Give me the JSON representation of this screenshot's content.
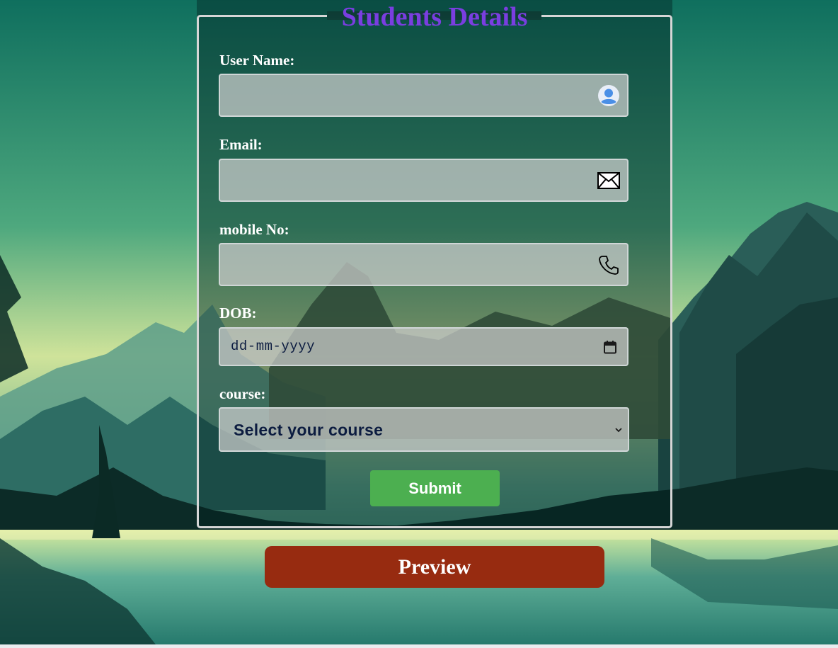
{
  "form": {
    "legend": "Students Details",
    "fields": [
      {
        "label": "User Name:",
        "value": "",
        "icon": "user-avatar-icon"
      },
      {
        "label": "Email:",
        "value": "",
        "icon": "envelope-icon"
      },
      {
        "label": "mobile No:",
        "value": "",
        "icon": "phone-icon"
      }
    ],
    "dob": {
      "label": "DOB:",
      "placeholder": "dd-mm-yyyy",
      "icon": "calendar-icon"
    },
    "course": {
      "label": "course:",
      "selected": "Select your course",
      "icon": "chevron-down-icon"
    },
    "submit_label": "Submit"
  },
  "preview_label": "Preview",
  "colors": {
    "legend": "#7a3ee0",
    "submit": "#4caf50",
    "preview": "#972b10",
    "input_bg": "#cecece",
    "text_dark": "#0c1c40"
  }
}
